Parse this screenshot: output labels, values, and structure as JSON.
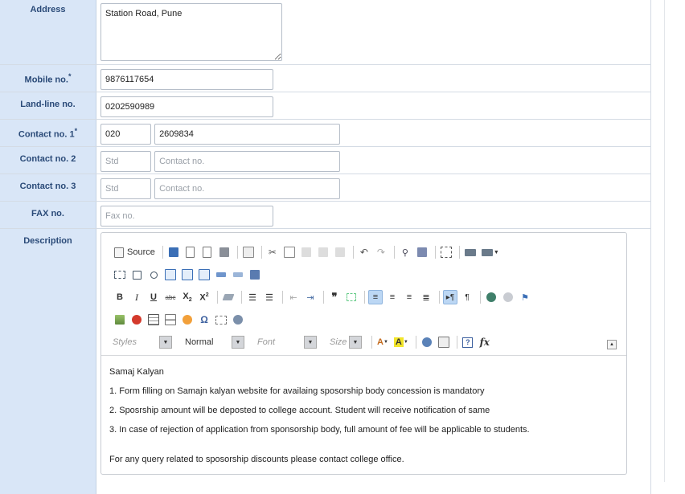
{
  "fields": {
    "address": {
      "label": "Address",
      "value": "Station Road, Pune"
    },
    "mobile": {
      "label": "Mobile no.",
      "required_mark": "*",
      "value": "9876117654"
    },
    "landline": {
      "label": "Land-line no.",
      "value": "0202590989"
    },
    "contact1": {
      "label": "Contact no. 1",
      "required_mark": "*",
      "std_value": "020",
      "number_value": "2609834"
    },
    "contact2": {
      "label": "Contact no. 2",
      "std_placeholder": "Std",
      "number_placeholder": "Contact no."
    },
    "contact3": {
      "label": "Contact no. 3",
      "std_placeholder": "Std",
      "number_placeholder": "Contact no."
    },
    "fax": {
      "label": "FAX no.",
      "placeholder": "Fax no."
    },
    "description": {
      "label": "Description"
    }
  },
  "editor": {
    "source_label": "Source",
    "combos": {
      "styles": "Styles",
      "format": "Normal",
      "font": "Font",
      "size": "Size"
    },
    "content": {
      "title": "Samaj Kalyan",
      "lines": [
        "1. Form filling on Samajn kalyan website for availaing sposorship body concession is mandatory",
        "2. Sposrship amount will be deposted to college account. Student will receive notification of same",
        "3. In case of rejection of application from sponsorship body, full amount of fee will be applicable to students.",
        "For any query related to sposorship discounts please contact college office."
      ]
    }
  },
  "colors": {
    "label_bg": "#d9e6f7",
    "label_text": "#2a4a78",
    "active_button": "#bcd7f4"
  }
}
